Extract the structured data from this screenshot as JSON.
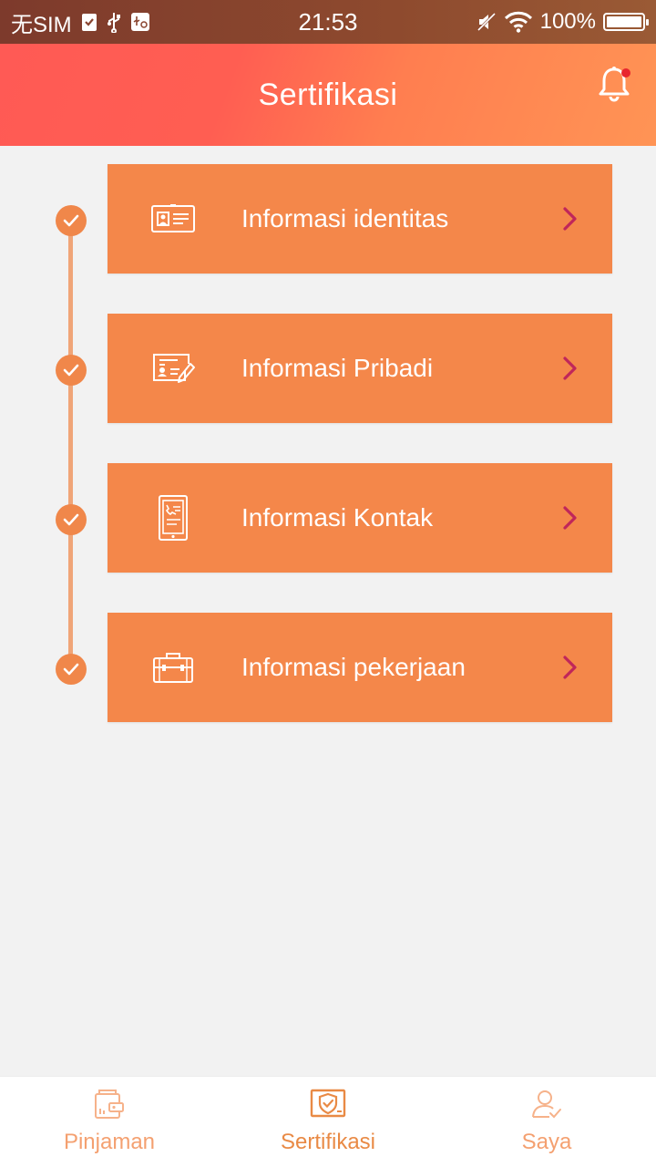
{
  "status_bar": {
    "carrier": "无SIM",
    "time": "21:53",
    "battery": "100%",
    "icons": [
      "clipboard-check-icon",
      "usb-icon",
      "usb-debug-icon",
      "mute-icon",
      "wifi-icon",
      "battery-icon"
    ]
  },
  "header": {
    "title": "Sertifikasi",
    "bell_icon": "bell-icon",
    "has_notification": true
  },
  "steps": [
    {
      "label": "Informasi identitas",
      "icon": "id-card-icon",
      "completed": true
    },
    {
      "label": "Informasi Pribadi",
      "icon": "personal-form-icon",
      "completed": true
    },
    {
      "label": "Informasi Kontak",
      "icon": "phone-contact-icon",
      "completed": true
    },
    {
      "label": "Informasi pekerjaan",
      "icon": "briefcase-icon",
      "completed": true
    }
  ],
  "nav": {
    "items": [
      {
        "label": "Pinjaman",
        "icon": "wallet-icon",
        "active": false
      },
      {
        "label": "Sertifikasi",
        "icon": "shield-certificate-icon",
        "active": true
      },
      {
        "label": "Saya",
        "icon": "user-icon",
        "active": false
      }
    ]
  },
  "colors": {
    "card": "#f4874a",
    "chevron": "#c0265a",
    "background": "#f2f2f2",
    "nav_label": "#f4a070"
  }
}
